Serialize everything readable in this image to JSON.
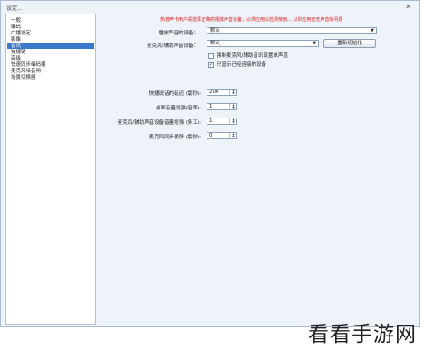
{
  "window": {
    "title": "设定...",
    "close_glyph": "✕"
  },
  "sidebar": {
    "items": [
      {
        "label": "一般",
        "selected": false
      },
      {
        "label": "编码",
        "selected": false
      },
      {
        "label": "广播设定",
        "selected": false
      },
      {
        "label": "影像",
        "selected": false
      },
      {
        "label": "音讯",
        "selected": true
      },
      {
        "label": "快捷键",
        "selected": false
      },
      {
        "label": "高级",
        "selected": false
      },
      {
        "label": "快速同步编码器",
        "selected": false
      },
      {
        "label": "麦克风噪音闸",
        "selected": false
      },
      {
        "label": "场景切换器",
        "selected": false
      }
    ]
  },
  "main": {
    "hint": "热普声卡用户请选择正确的播放声音设备，以供应用以检测使用... 以供应用查无声音的问题",
    "playback_label": "播放声音的设备：",
    "playback_value": "默认",
    "mic_label": "麦克风/辅助声音设备：",
    "mic_value": "默认",
    "reinit_button": "重新初始化",
    "force_mono_label": "强制麦克风/辅助音讯设置单声道",
    "only_connected_label": "只显示已经连接的设备",
    "force_mono_checked": false,
    "only_connected_checked": true,
    "hotkey_delay_label": "快捷说话的延迟 (毫秒):",
    "hotkey_delay_value": "200",
    "desktop_boost_label": "桌面音量增强(倍率):",
    "desktop_boost_value": "1",
    "mic_boost_label": "麦克风/辅助声音设备音量增强 (多工):",
    "mic_boost_value": "1",
    "mic_sync_label": "麦克风同步偏移 (毫秒):",
    "mic_sync_value": "0",
    "check_glyph": "✓",
    "dropdown_glyph": "▼",
    "spin_up_glyph": "▲",
    "spin_down_glyph": "▼"
  },
  "watermark": {
    "text": "看看手游网"
  }
}
